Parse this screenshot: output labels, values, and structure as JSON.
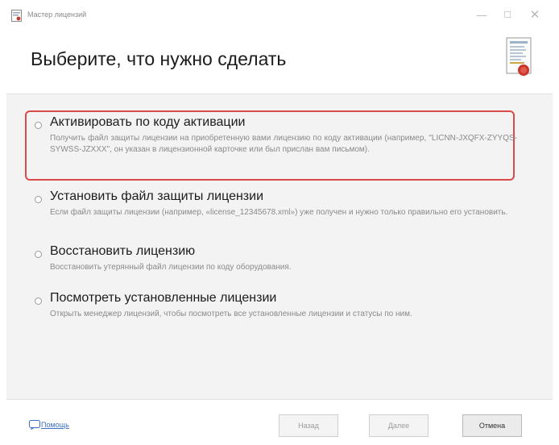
{
  "window": {
    "title": "Мастер лицензий",
    "min_glyph": "—",
    "max_glyph": "☐",
    "close_glyph": "✕"
  },
  "header": {
    "title": "Выберите, что нужно сделать"
  },
  "options": [
    {
      "title": "Активировать по коду активации",
      "description": "Получить файл защиты лицензии на приобретенную вами лицензию по коду активации (например, \"LICNN-JXQFX-ZYYQS-SYWSS-JZXXX\", он указан в лицензионной карточке или был прислан вам письмом).",
      "selected": false,
      "highlighted": true
    },
    {
      "title": "Установить файл защиты лицензии",
      "description": "Если файл защиты лицензии (например, «license_12345678.xml») уже получен и нужно только правильно его установить.",
      "selected": false,
      "highlighted": false
    },
    {
      "title": "Восстановить лицензию",
      "description": "Восстановить утерянный файл лицензии по коду оборудования.",
      "selected": false,
      "highlighted": false
    },
    {
      "title": "Посмотреть установленные лицензии",
      "description": "Открыть менеджер лицензий, чтобы посмотреть все установленные лицензии и статусы по ним.",
      "selected": false,
      "highlighted": false
    }
  ],
  "footer": {
    "help_label": "Помощь",
    "back_label": "Назад",
    "next_label": "Далее",
    "cancel_label": "Отмена"
  },
  "colors": {
    "highlight": "#d94a4a",
    "link": "#3b6fc8",
    "content_bg": "#f3f3f3"
  },
  "icons": {
    "app": "app-window-icon",
    "header": "license-certificate-icon",
    "help": "help-chat-icon"
  }
}
